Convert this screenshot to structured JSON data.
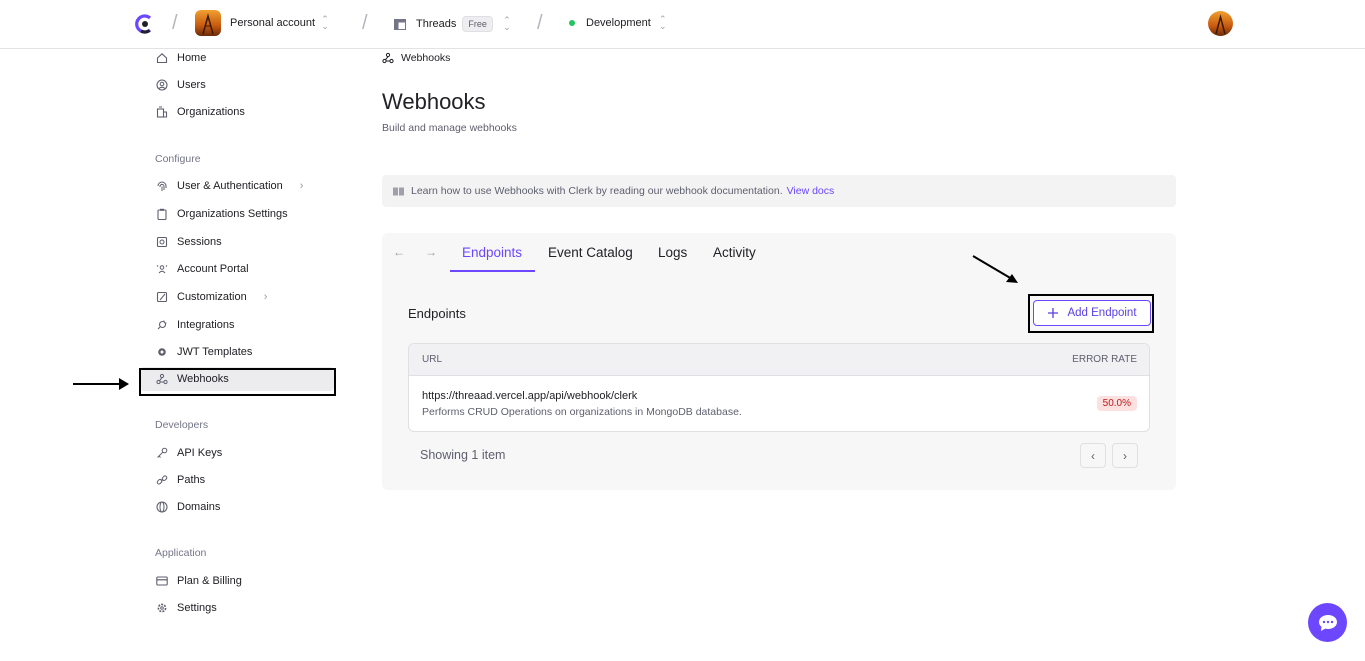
{
  "topbar": {
    "account": "Personal account",
    "app": "Threads",
    "app_badge": "Free",
    "environment": "Development"
  },
  "sidebar": {
    "top_items": [
      {
        "label": "Home",
        "icon": "home-icon"
      },
      {
        "label": "Users",
        "icon": "user-circle-icon"
      },
      {
        "label": "Organizations",
        "icon": "building-icon"
      }
    ],
    "configure_title": "Configure",
    "configure_items": [
      {
        "label": "User & Authentication",
        "icon": "fingerprint-icon",
        "expandable": true
      },
      {
        "label": "Organizations Settings",
        "icon": "clipboard-icon"
      },
      {
        "label": "Sessions",
        "icon": "sessions-icon"
      },
      {
        "label": "Account Portal",
        "icon": "portal-icon"
      },
      {
        "label": "Customization",
        "icon": "customize-icon",
        "expandable": true
      },
      {
        "label": "Integrations",
        "icon": "plug-icon"
      },
      {
        "label": "JWT Templates",
        "icon": "gear-small-icon"
      },
      {
        "label": "Webhooks",
        "icon": "webhook-icon",
        "active": true
      }
    ],
    "developers_title": "Developers",
    "developers_items": [
      {
        "label": "API Keys",
        "icon": "key-icon"
      },
      {
        "label": "Paths",
        "icon": "link-icon"
      },
      {
        "label": "Domains",
        "icon": "globe-icon"
      }
    ],
    "application_title": "Application",
    "application_items": [
      {
        "label": "Plan & Billing",
        "icon": "card-icon"
      },
      {
        "label": "Settings",
        "icon": "gear-icon"
      }
    ]
  },
  "breadcrumb": "Webhooks",
  "page": {
    "title": "Webhooks",
    "subtitle": "Build and manage webhooks"
  },
  "info": {
    "text": "Learn how to use Webhooks with Clerk by reading our webhook documentation.",
    "link": "View docs"
  },
  "tabs": [
    "Endpoints",
    "Event Catalog",
    "Logs",
    "Activity"
  ],
  "active_tab": "Endpoints",
  "endpoints": {
    "title": "Endpoints",
    "add_button": "Add Endpoint",
    "columns": [
      "URL",
      "ERROR RATE"
    ],
    "rows": [
      {
        "url": "https://threaad.vercel.app/api/webhook/clerk",
        "description": "Performs CRUD Operations on organizations in MongoDB database.",
        "error_rate": "50.0%"
      }
    ],
    "showing": "Showing 1 item"
  },
  "colors": {
    "accent": "#6c47ff",
    "error_badge_bg": "#fde0e0",
    "error_badge_text": "#b91c1c",
    "status_dot": "#22c55e"
  }
}
